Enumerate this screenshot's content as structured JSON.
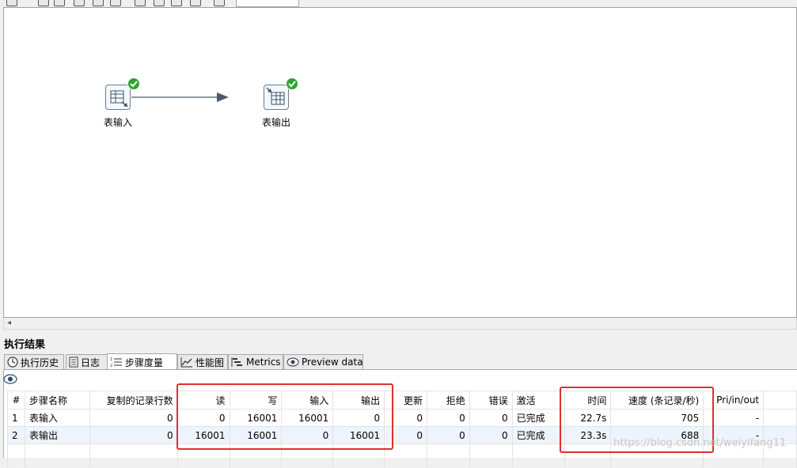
{
  "canvas": {
    "steps": [
      {
        "label": "表输入"
      },
      {
        "label": "表输出"
      }
    ]
  },
  "panel": {
    "title": "执行结果",
    "tabs": [
      {
        "label": "执行历史",
        "icon": "clock-icon"
      },
      {
        "label": "日志",
        "icon": "document-icon"
      },
      {
        "label": "步骤度量",
        "icon": "list-icon",
        "active": true
      },
      {
        "label": "性能图",
        "icon": "line-chart-icon"
      },
      {
        "label": "Metrics",
        "icon": "gantt-icon"
      },
      {
        "label": "Preview data",
        "icon": "eye-icon"
      }
    ]
  },
  "table": {
    "headers": [
      "#",
      "步骤名称",
      "复制的记录行数",
      "读",
      "写",
      "输入",
      "输出",
      "更新",
      "拒绝",
      "错误",
      "激活",
      "时间",
      "速度 (条记录/秒)",
      "Pri/in/out"
    ],
    "rows": [
      [
        "1",
        "表输入",
        "0",
        "0",
        "16001",
        "16001",
        "0",
        "0",
        "0",
        "0",
        "已完成",
        "22.7s",
        "705",
        "-"
      ],
      [
        "2",
        "表输出",
        "0",
        "16001",
        "16001",
        "0",
        "16001",
        "0",
        "0",
        "0",
        "已完成",
        "23.3s",
        "688",
        "-"
      ]
    ]
  },
  "watermark": "https://blog.csdn.net/weiyifang11",
  "colors": {
    "highlight": "#e0302c",
    "success": "#2ea32e",
    "row_alt": "#eef4fb"
  }
}
